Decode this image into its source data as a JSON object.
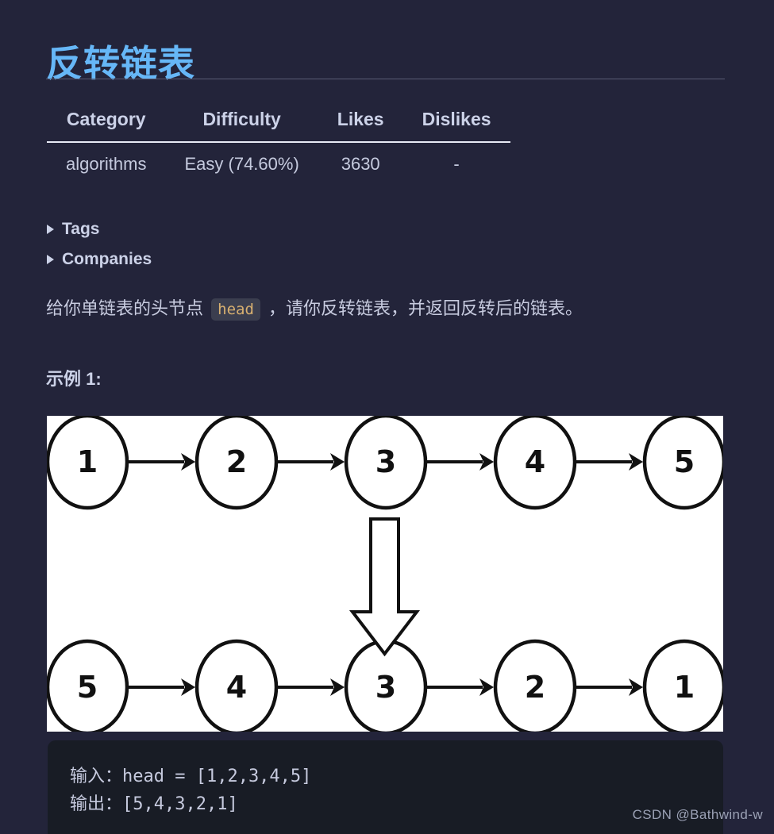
{
  "page": {
    "title": "反转链表",
    "background_color": "#23243a",
    "title_color": "#66b7f7"
  },
  "meta_table": {
    "headers": [
      "Category",
      "Difficulty",
      "Likes",
      "Dislikes"
    ],
    "rows": [
      [
        "algorithms",
        "Easy (74.60%)",
        "3630",
        "-"
      ]
    ]
  },
  "collapsible_sections": [
    {
      "label": "Tags",
      "expanded": false,
      "marker": "▶"
    },
    {
      "label": "Companies",
      "expanded": false,
      "marker": "▶"
    }
  ],
  "description": {
    "before_code": "给你单链表的头节点 ",
    "inline_code": "head",
    "after_code": " ，请你反转链表，并返回反转后的链表。"
  },
  "example": {
    "heading": "示例 1:",
    "code_lines": [
      "输入：head = [1,2,3,4,5]",
      "输出：[5,4,3,2,1]"
    ]
  },
  "illustration": {
    "top_row_values": [
      "1",
      "2",
      "3",
      "4",
      "5"
    ],
    "bottom_row_values": [
      "5",
      "4",
      "3",
      "2",
      "1"
    ],
    "arrow_direction": "down",
    "background_color": "#ffffff",
    "stroke_color": "#111111"
  },
  "watermark": "CSDN @Bathwind-w"
}
